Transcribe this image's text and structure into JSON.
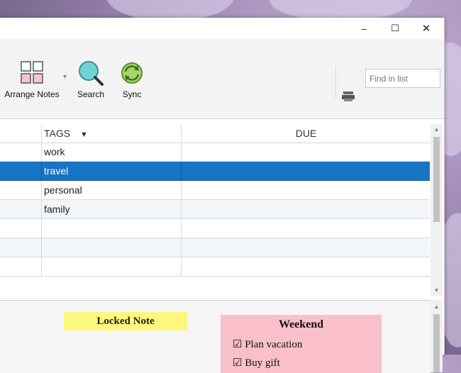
{
  "window": {
    "controls": {
      "minimize": "–",
      "maximize": "☐",
      "close": "✕"
    }
  },
  "toolbar": {
    "arrange_label": "Arrange Notes",
    "search_label": "Search",
    "sync_label": "Sync",
    "dropdown_glyph": "▾",
    "find_placeholder": "Find in list"
  },
  "table": {
    "columns": [
      {
        "label": "TAGS",
        "sort_glyph": "▼"
      },
      {
        "label": "DUE"
      }
    ],
    "rows": [
      {
        "tags": "work",
        "due": ""
      },
      {
        "tags": "travel",
        "due": "",
        "selected": true
      },
      {
        "tags": "personal",
        "due": ""
      },
      {
        "tags": "family",
        "due": ""
      },
      {
        "tags": "",
        "due": ""
      },
      {
        "tags": "",
        "due": ""
      },
      {
        "tags": "",
        "due": ""
      }
    ]
  },
  "notes": {
    "locked": {
      "title": "Locked Note",
      "color": "#fdf77d"
    },
    "weekend": {
      "title": "Weekend",
      "color": "#f9c0cb",
      "items": [
        {
          "check": "☑",
          "text": "Plan vacation"
        },
        {
          "check": "☑",
          "text": "Buy gift"
        }
      ]
    }
  },
  "colors": {
    "selection": "#1874c4",
    "sync_green": "#8bc34a",
    "search_cyan": "#6ed3d3"
  }
}
